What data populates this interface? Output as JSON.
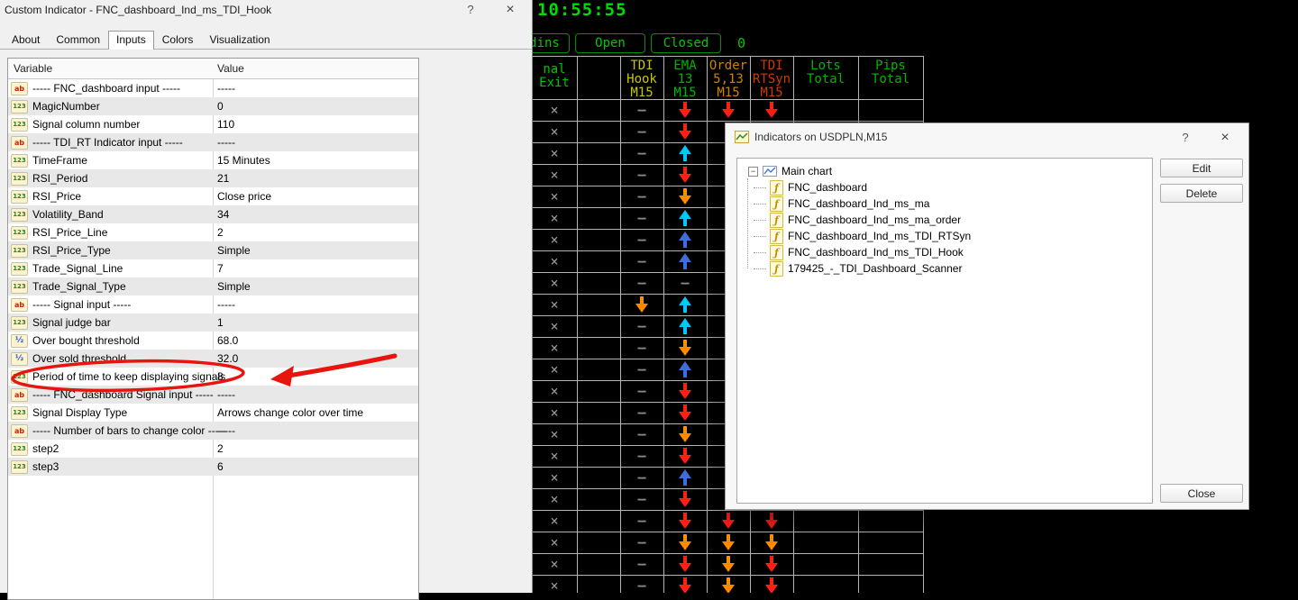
{
  "indicator_dialog": {
    "title": "Custom Indicator - FNC_dashboard_Ind_ms_TDI_Hook",
    "help_label": "?",
    "close_label": "×",
    "tabs": [
      {
        "label": "About",
        "active": false
      },
      {
        "label": "Common",
        "active": false
      },
      {
        "label": "Inputs",
        "active": true
      },
      {
        "label": "Colors",
        "active": false
      },
      {
        "label": "Visualization",
        "active": false
      }
    ],
    "table": {
      "col_variable": "Variable",
      "col_value": "Value",
      "icon_glyphs": {
        "ab": "ab",
        "int": "123",
        "frac": "½"
      },
      "rows": [
        {
          "icon": "ab",
          "variable": "----- FNC_dashboard input -----",
          "value": "-----"
        },
        {
          "icon": "int",
          "variable": "MagicNumber",
          "value": "0"
        },
        {
          "icon": "int",
          "variable": "Signal column number",
          "value": "110"
        },
        {
          "icon": "ab",
          "variable": "----- TDI_RT Indicator input -----",
          "value": "-----"
        },
        {
          "icon": "int",
          "variable": "TimeFrame",
          "value": "15 Minutes"
        },
        {
          "icon": "int",
          "variable": "RSI_Period",
          "value": "21"
        },
        {
          "icon": "int",
          "variable": "RSI_Price",
          "value": "Close price"
        },
        {
          "icon": "int",
          "variable": "Volatility_Band",
          "value": "34"
        },
        {
          "icon": "int",
          "variable": "RSI_Price_Line",
          "value": "2"
        },
        {
          "icon": "int",
          "variable": "RSI_Price_Type",
          "value": "Simple"
        },
        {
          "icon": "int",
          "variable": "Trade_Signal_Line",
          "value": "7"
        },
        {
          "icon": "int",
          "variable": "Trade_Signal_Type",
          "value": "Simple"
        },
        {
          "icon": "ab",
          "variable": "----- Signal input -----",
          "value": "-----"
        },
        {
          "icon": "int",
          "variable": "Signal judge bar",
          "value": "1"
        },
        {
          "icon": "frac",
          "variable": "Over bought threshold",
          "value": "68.0"
        },
        {
          "icon": "frac",
          "variable": "Over sold threshold",
          "value": "32.0"
        },
        {
          "icon": "int",
          "variable": "Period of time to keep displaying signals",
          "value": "8"
        },
        {
          "icon": "ab",
          "variable": "----- FNC_dashboard Signal input -----",
          "value": "-----"
        },
        {
          "icon": "int",
          "variable": "Signal Display Type",
          "value": "Arrows change color over time"
        },
        {
          "icon": "ab",
          "variable": "----- Number of bars to change color -----",
          "value": "-----"
        },
        {
          "icon": "int",
          "variable": "step2",
          "value": "2"
        },
        {
          "icon": "int",
          "variable": "step3",
          "value": "6"
        }
      ]
    }
  },
  "dashboard": {
    "clock": "10:55:55",
    "buttons": [
      "dins",
      "Open",
      "Closed"
    ],
    "counter": "0",
    "header_cols": [
      {
        "col": 0,
        "lines": [
          "nal",
          "Exit"
        ],
        "color": "#00c400"
      },
      {
        "col": 2,
        "lines": [
          "TDI",
          "Hook",
          "M15"
        ],
        "color": "#c6c600"
      },
      {
        "col": 3,
        "lines": [
          "EMA",
          "13",
          "M15"
        ],
        "color": "#00b400"
      },
      {
        "col": 4,
        "lines": [
          "Order",
          "5,13",
          "M15"
        ],
        "color": "#cc8400"
      },
      {
        "col": 5,
        "lines": [
          "TDI",
          "RTSyn",
          "M15"
        ],
        "color": "#cc3a00"
      },
      {
        "col": 6,
        "lines": [
          "Lots",
          "Total"
        ],
        "color": "#00b400"
      },
      {
        "col": 7,
        "lines": [
          "Pips",
          "Total"
        ],
        "color": "#00b400"
      }
    ],
    "symbol_colors": {
      "x": "#9c9c9c",
      "dash": "#8c8c8c",
      "dn_red": "#ff2015",
      "dn_org": "#ff8c00",
      "up_cyan": "#00c8f0",
      "up_blue": "#3d6fd6"
    },
    "grid_rows": [
      [
        "x",
        "",
        "-",
        "dn_red",
        "dn_red",
        "dn_red",
        "",
        ""
      ],
      [
        "x",
        "",
        "-",
        "dn_red",
        "",
        "",
        "",
        ""
      ],
      [
        "x",
        "",
        "-",
        "up_cyan",
        "",
        "",
        "",
        ""
      ],
      [
        "x",
        "",
        "-",
        "dn_red",
        "",
        "",
        "",
        ""
      ],
      [
        "x",
        "",
        "-",
        "dn_org",
        "",
        "",
        "",
        ""
      ],
      [
        "x",
        "",
        "-",
        "up_cyan",
        "",
        "",
        "",
        ""
      ],
      [
        "x",
        "",
        "-",
        "up_blue",
        "",
        "",
        "",
        ""
      ],
      [
        "x",
        "",
        "-",
        "up_blue",
        "",
        "",
        "",
        ""
      ],
      [
        "x",
        "",
        "-",
        "-",
        "",
        "",
        "",
        ""
      ],
      [
        "x",
        "",
        "dn_org",
        "up_cyan",
        "",
        "",
        "",
        ""
      ],
      [
        "x",
        "",
        "-",
        "up_cyan",
        "",
        "",
        "",
        ""
      ],
      [
        "x",
        "",
        "-",
        "dn_org",
        "",
        "",
        "",
        ""
      ],
      [
        "x",
        "",
        "-",
        "up_blue",
        "",
        "",
        "",
        ""
      ],
      [
        "x",
        "",
        "-",
        "dn_red",
        "",
        "",
        "",
        ""
      ],
      [
        "x",
        "",
        "-",
        "dn_red",
        "",
        "",
        "",
        ""
      ],
      [
        "x",
        "",
        "-",
        "dn_org",
        "",
        "",
        "",
        ""
      ],
      [
        "x",
        "",
        "-",
        "dn_red",
        "",
        "",
        "",
        ""
      ],
      [
        "x",
        "",
        "-",
        "up_blue",
        "",
        "",
        "",
        ""
      ],
      [
        "x",
        "",
        "-",
        "dn_red",
        "",
        "",
        "",
        ""
      ],
      [
        "x",
        "",
        "-",
        "dn_red",
        "dn_red",
        "dn_red",
        "",
        ""
      ],
      [
        "x",
        "",
        "-",
        "dn_org",
        "dn_org",
        "dn_org",
        "",
        ""
      ],
      [
        "x",
        "",
        "-",
        "dn_red",
        "dn_org",
        "dn_red",
        "",
        ""
      ],
      [
        "x",
        "",
        "-",
        "dn_red",
        "dn_org",
        "dn_red",
        "",
        ""
      ]
    ]
  },
  "indicators_dialog": {
    "title": "Indicators on USDPLN,M15",
    "help_label": "?",
    "close_label": "×",
    "tree_root": "Main chart",
    "tree_items": [
      "FNC_dashboard",
      "FNC_dashboard_Ind_ms_ma",
      "FNC_dashboard_Ind_ms_ma_order",
      "FNC_dashboard_Ind_ms_TDI_RTSyn",
      "FNC_dashboard_Ind_ms_TDI_Hook",
      "179425_-_TDI_Dashboard_Scanner"
    ],
    "buttons": {
      "edit": "Edit",
      "delete": "Delete",
      "close": "Close"
    }
  },
  "annotation": {
    "color": "#e8140e"
  }
}
